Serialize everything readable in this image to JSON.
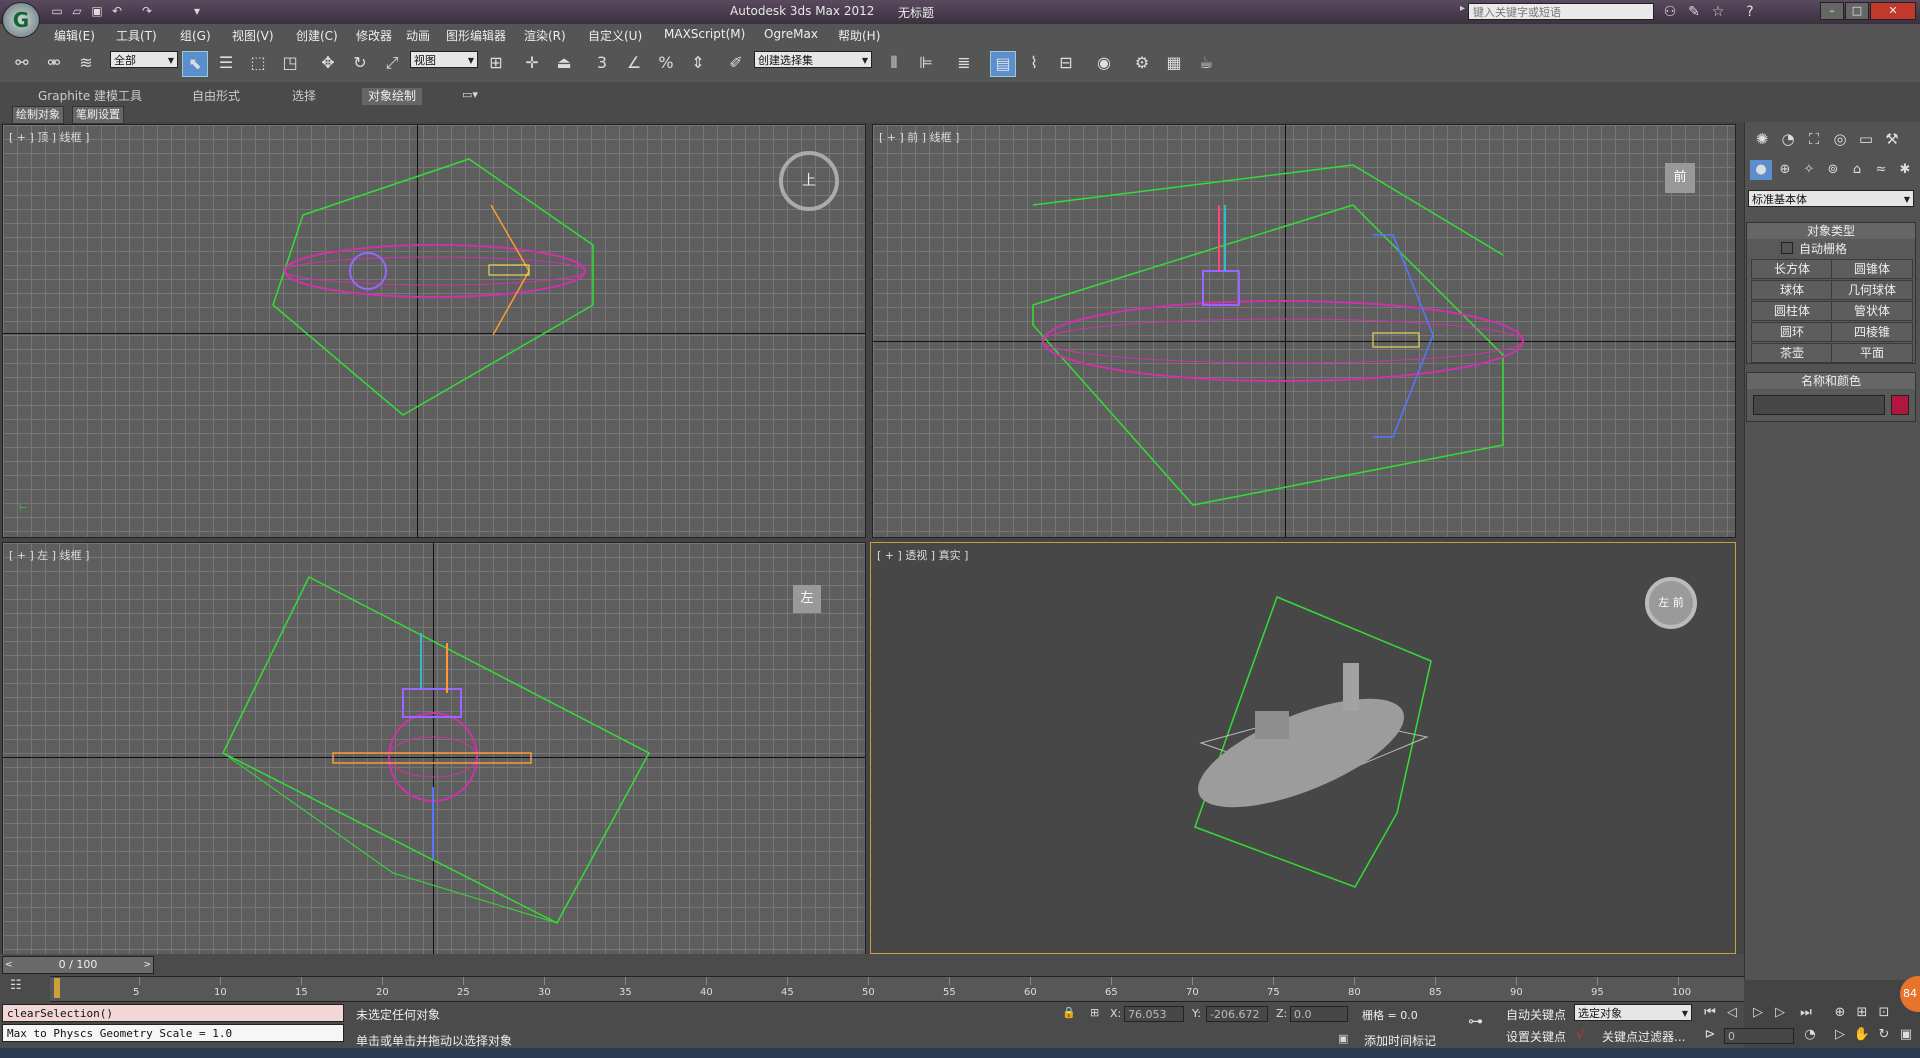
{
  "title": {
    "app": "Autodesk 3ds Max  2012",
    "doc": "无标题",
    "logo_letter": "G"
  },
  "quick_access": [
    "new-icon",
    "open-icon",
    "save-icon",
    "undo-icon",
    "redo-icon",
    "dropdown-icon"
  ],
  "search": {
    "placeholder": "键入关键字或短语"
  },
  "menu": [
    "编辑(E)",
    "工具(T)",
    "组(G)",
    "视图(V)",
    "创建(C)",
    "修改器",
    "动画",
    "图形编辑器",
    "渲染(R)",
    "自定义(U)",
    "MAXScript(M)",
    "OgreMax",
    "帮助(H)"
  ],
  "toolbar": {
    "selection_filter": "全部",
    "ref_coord": "视图",
    "named_selection": "创建选择集",
    "snap_label": "3",
    "angle_label": "%"
  },
  "ribbon": {
    "tabs": [
      "Graphite 建模工具",
      "自由形式",
      "选择",
      "对象绘制"
    ],
    "active_tab": "对象绘制",
    "sub": [
      "绘制对象",
      "笔刷设置"
    ]
  },
  "viewports": {
    "top": "[ + ] 顶 ] 线框 ]",
    "front": "[ + ] 前 ] 线框 ]",
    "left": "[ + ] 左 ] 线框 ]",
    "persp": "[ + ] 透视 ] 真实 ]",
    "cube_top": "上",
    "cube_front": "前",
    "cube_left": "左",
    "cube_persp": "左 前"
  },
  "command_panel": {
    "category": "标准基本体",
    "object_type_title": "对象类型",
    "autogrid": "自动栅格",
    "buttons": [
      "长方体",
      "圆锥体",
      "球体",
      "几何球体",
      "圆柱体",
      "管状体",
      "圆环",
      "四棱锥",
      "茶壶",
      "平面"
    ],
    "name_color_title": "名称和颜色",
    "name_value": "",
    "swatch_color": "#b0173f"
  },
  "timeline": {
    "frame": "0 / 100",
    "ticks": [
      "5",
      "10",
      "15",
      "20",
      "25",
      "30",
      "35",
      "40",
      "45",
      "50",
      "55",
      "60",
      "65",
      "70",
      "75",
      "80",
      "85",
      "90",
      "95",
      "100"
    ]
  },
  "maxscript": {
    "line1": "clearSelection()",
    "line2": "Max to Physcs Geometry Scale = 1.0"
  },
  "status": {
    "selection": "未选定任何对象",
    "prompt": "单击或单击并拖动以选择对象",
    "x_label": "X:",
    "x": "76.053",
    "y_label": "Y:",
    "y": "-206.672",
    "z_label": "Z:",
    "z": "0.0",
    "grid": "栅格 = 0.0",
    "add_time_tag": "添加时间标记",
    "auto_key": "自动关键点",
    "set_key": "设置关键点",
    "key_mode": "选定对象",
    "key_filters": "关键点过滤器...",
    "current_frame": "0",
    "badge": "84"
  }
}
